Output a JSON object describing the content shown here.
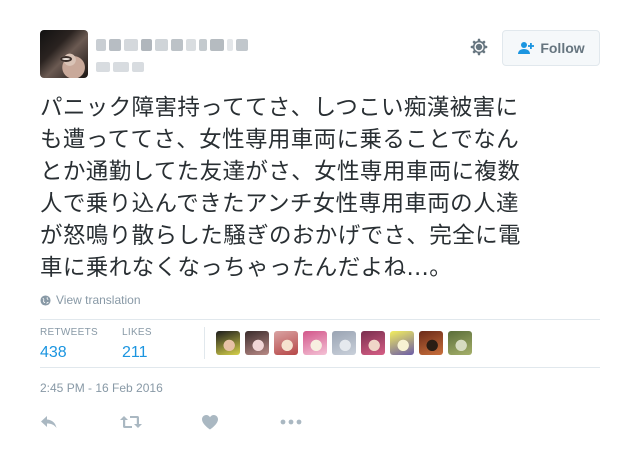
{
  "tweet": {
    "text_lines": [
      "パニック障害持っててさ、しつこい痴漢被害に",
      "も遭っててさ、女性専用車両に乗ることでなん",
      "とか通勤してた友達がさ、女性専用車両に複数",
      "人で乗り込んできたアンチ女性専用車両の人達",
      "が怒鳴り散らした騒ぎのおかげでさ、完全に電",
      "車に乗れなくなっちゃったんだよね…。"
    ],
    "translate_label": "View translation",
    "timestamp": "2:45 PM - 16 Feb 2016"
  },
  "header": {
    "follow_label": "Follow",
    "follow_icon": "add-user-icon",
    "settings_icon": "gear-icon"
  },
  "stats": {
    "retweets_label": "RETWEETS",
    "retweets_count": "438",
    "likes_label": "LIKES",
    "likes_count": "211"
  },
  "likers": [
    {
      "icon": "liker-avatar",
      "colors": [
        "#1d1d1d",
        "#d7d24a",
        "#e7c1a6"
      ]
    },
    {
      "icon": "liker-avatar",
      "colors": [
        "#3a2c2c",
        "#b98a86",
        "#f1d6d6"
      ]
    },
    {
      "icon": "liker-avatar",
      "colors": [
        "#d9a3a3",
        "#b64747",
        "#f6e2cf"
      ]
    },
    {
      "icon": "liker-avatar",
      "colors": [
        "#d2568a",
        "#f4c2d6",
        "#f7efe0"
      ]
    },
    {
      "icon": "liker-avatar",
      "colors": [
        "#9aa4b3",
        "#c9d0da",
        "#e5e9ee"
      ]
    },
    {
      "icon": "liker-avatar",
      "colors": [
        "#7a2f4f",
        "#d65e85",
        "#f0d6c8"
      ]
    },
    {
      "icon": "liker-avatar",
      "colors": [
        "#f3ef5e",
        "#6b5ba8",
        "#f7f2d2"
      ]
    },
    {
      "icon": "liker-avatar",
      "colors": [
        "#6b2a18",
        "#c96f3b",
        "#2b1d14"
      ]
    },
    {
      "icon": "liker-avatar",
      "colors": [
        "#5b6e3a",
        "#a5b06a",
        "#d6dbc0"
      ]
    }
  ],
  "actions": {
    "reply_icon": "reply-icon",
    "retweet_icon": "retweet-icon",
    "like_icon": "heart-icon",
    "more_icon": "more-icon"
  },
  "colors": {
    "link_blue": "#1b95e0",
    "muted_gray": "#8899a6",
    "text": "#292f33"
  }
}
